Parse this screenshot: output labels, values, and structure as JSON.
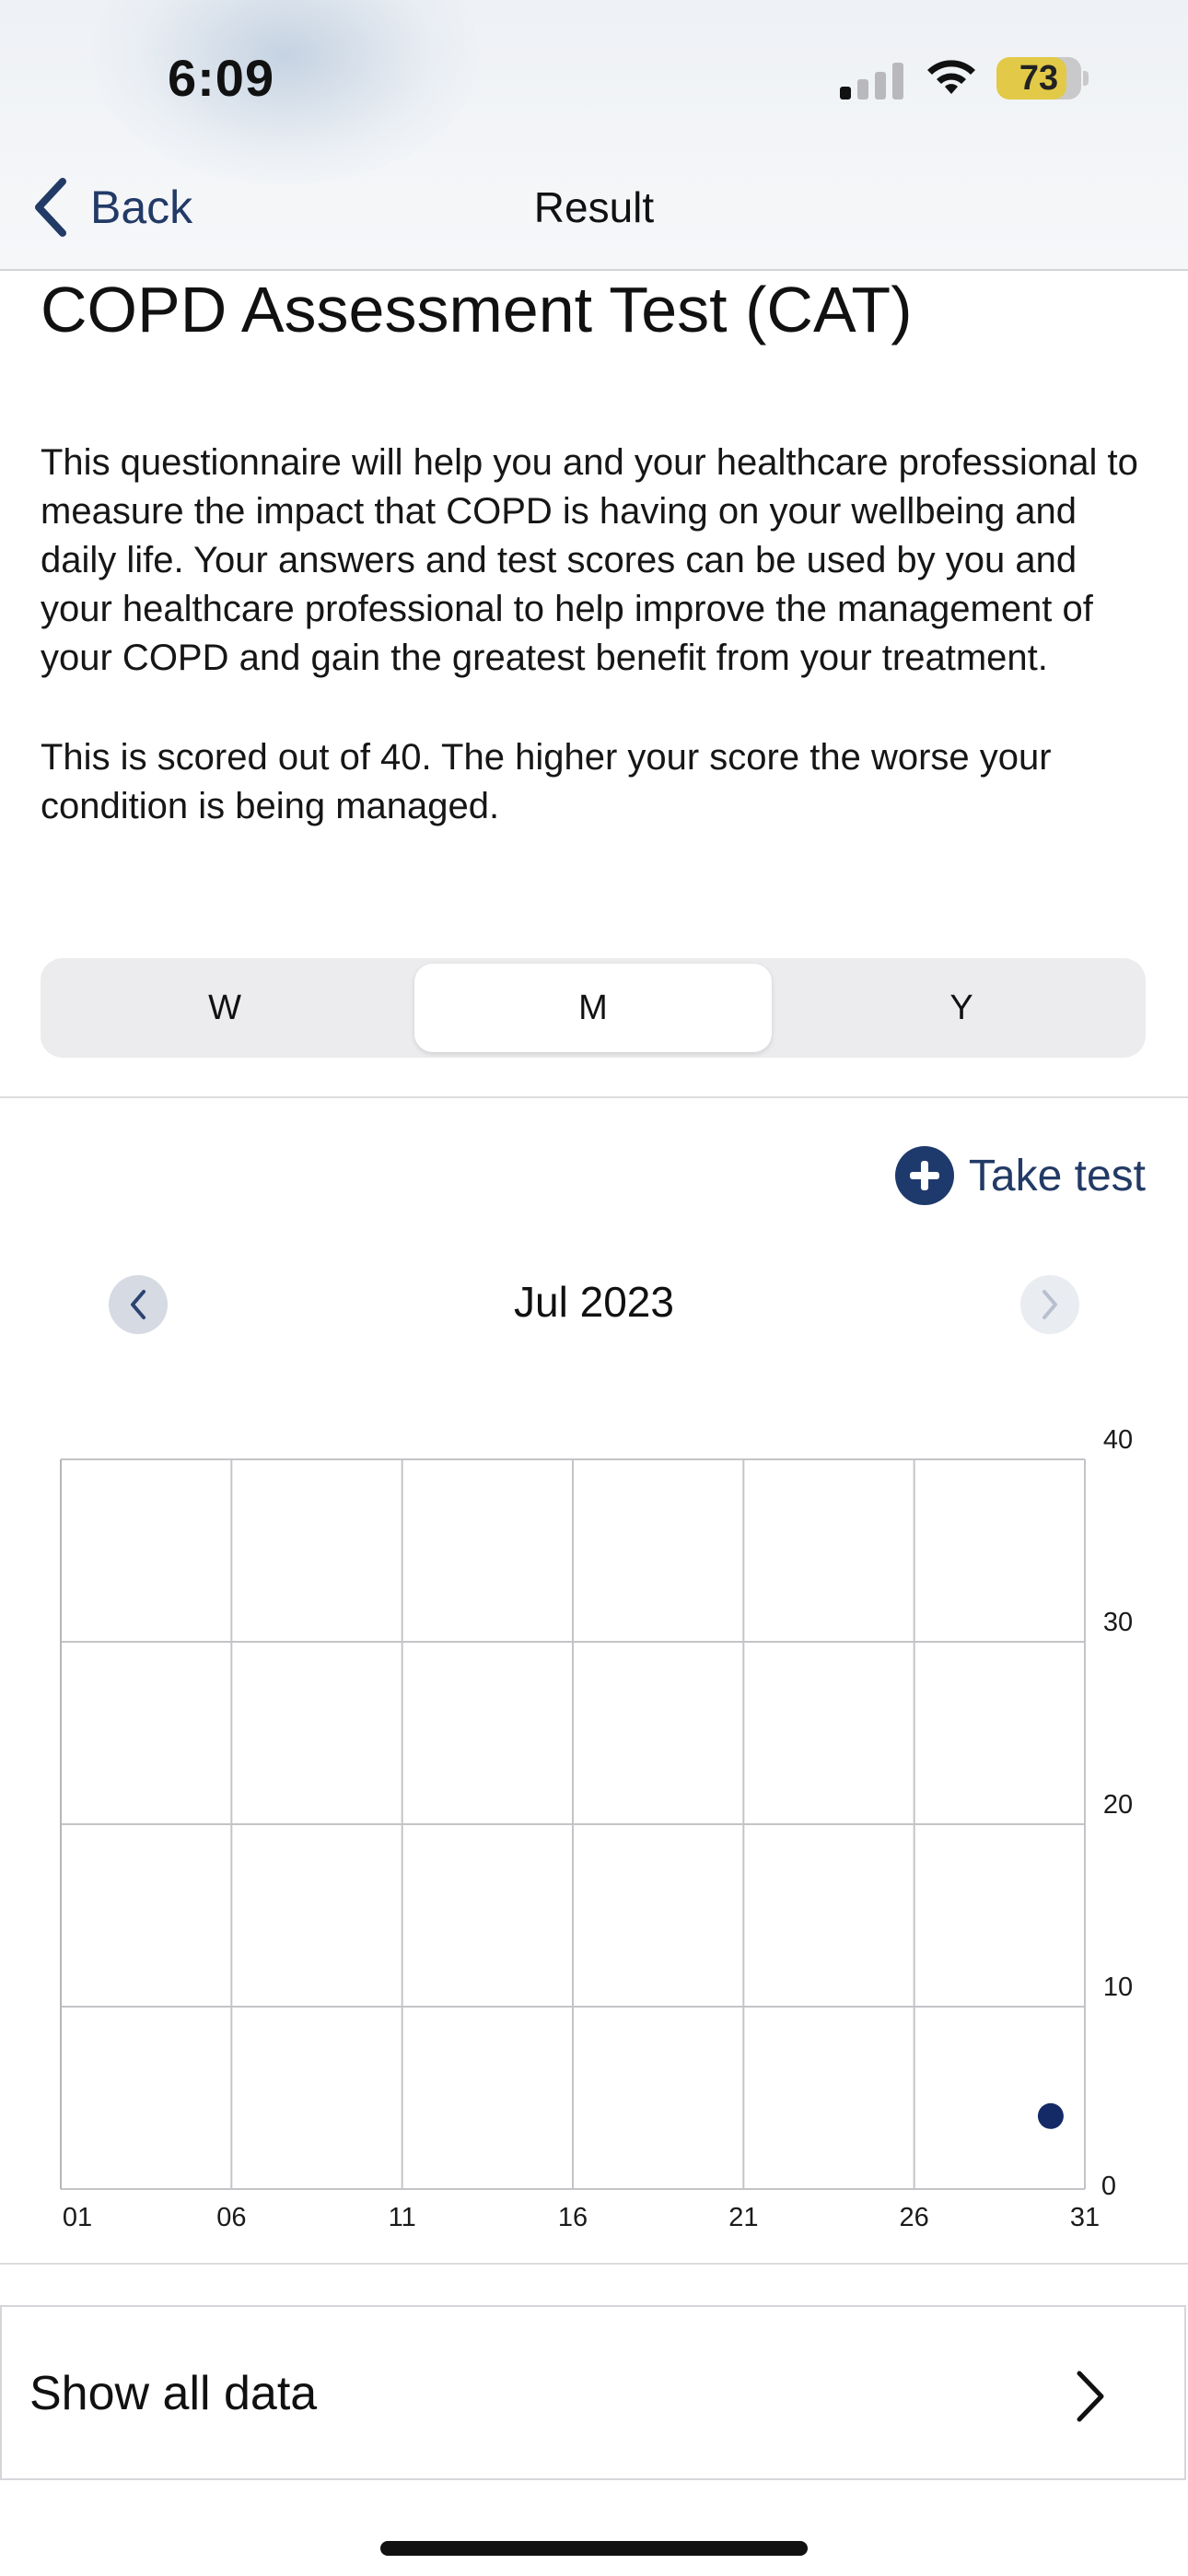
{
  "status_bar": {
    "time": "6:09",
    "battery_level": "73"
  },
  "nav": {
    "back_label": "Back",
    "title": "Result"
  },
  "page_title": "COPD Assessment Test (CAT)",
  "intro_text": "This questionnaire will help you and your healthcare professional to measure the impact that COPD is having on your wellbeing and daily life. Your answers and test scores can be used by you and your healthcare professional to help improve the management of your COPD and gain the greatest benefit from your treatment.",
  "scoring_text": "This is scored out of 40. The higher your score the worse your condition is being managed.",
  "range_selector": {
    "options": [
      "W",
      "M",
      "Y"
    ],
    "selected": "M"
  },
  "take_test_label": "Take test",
  "month_label": "Jul 2023",
  "show_all_label": "Show all data",
  "colors": {
    "accent": "#1e3a6c",
    "link": "#223a66",
    "data_point": "#142a66",
    "battery": "#e2c948"
  },
  "chart_data": {
    "type": "scatter",
    "x_ticks": [
      "01",
      "06",
      "11",
      "16",
      "21",
      "26",
      "31"
    ],
    "y_ticks": [
      "0",
      "10",
      "20",
      "30",
      "40"
    ],
    "xlim": [
      1,
      31
    ],
    "ylim": [
      0,
      40
    ],
    "grid": true,
    "y_axis_side": "right",
    "series": [
      {
        "points": [
          {
            "x": 30,
            "y": 4
          }
        ]
      }
    ]
  }
}
